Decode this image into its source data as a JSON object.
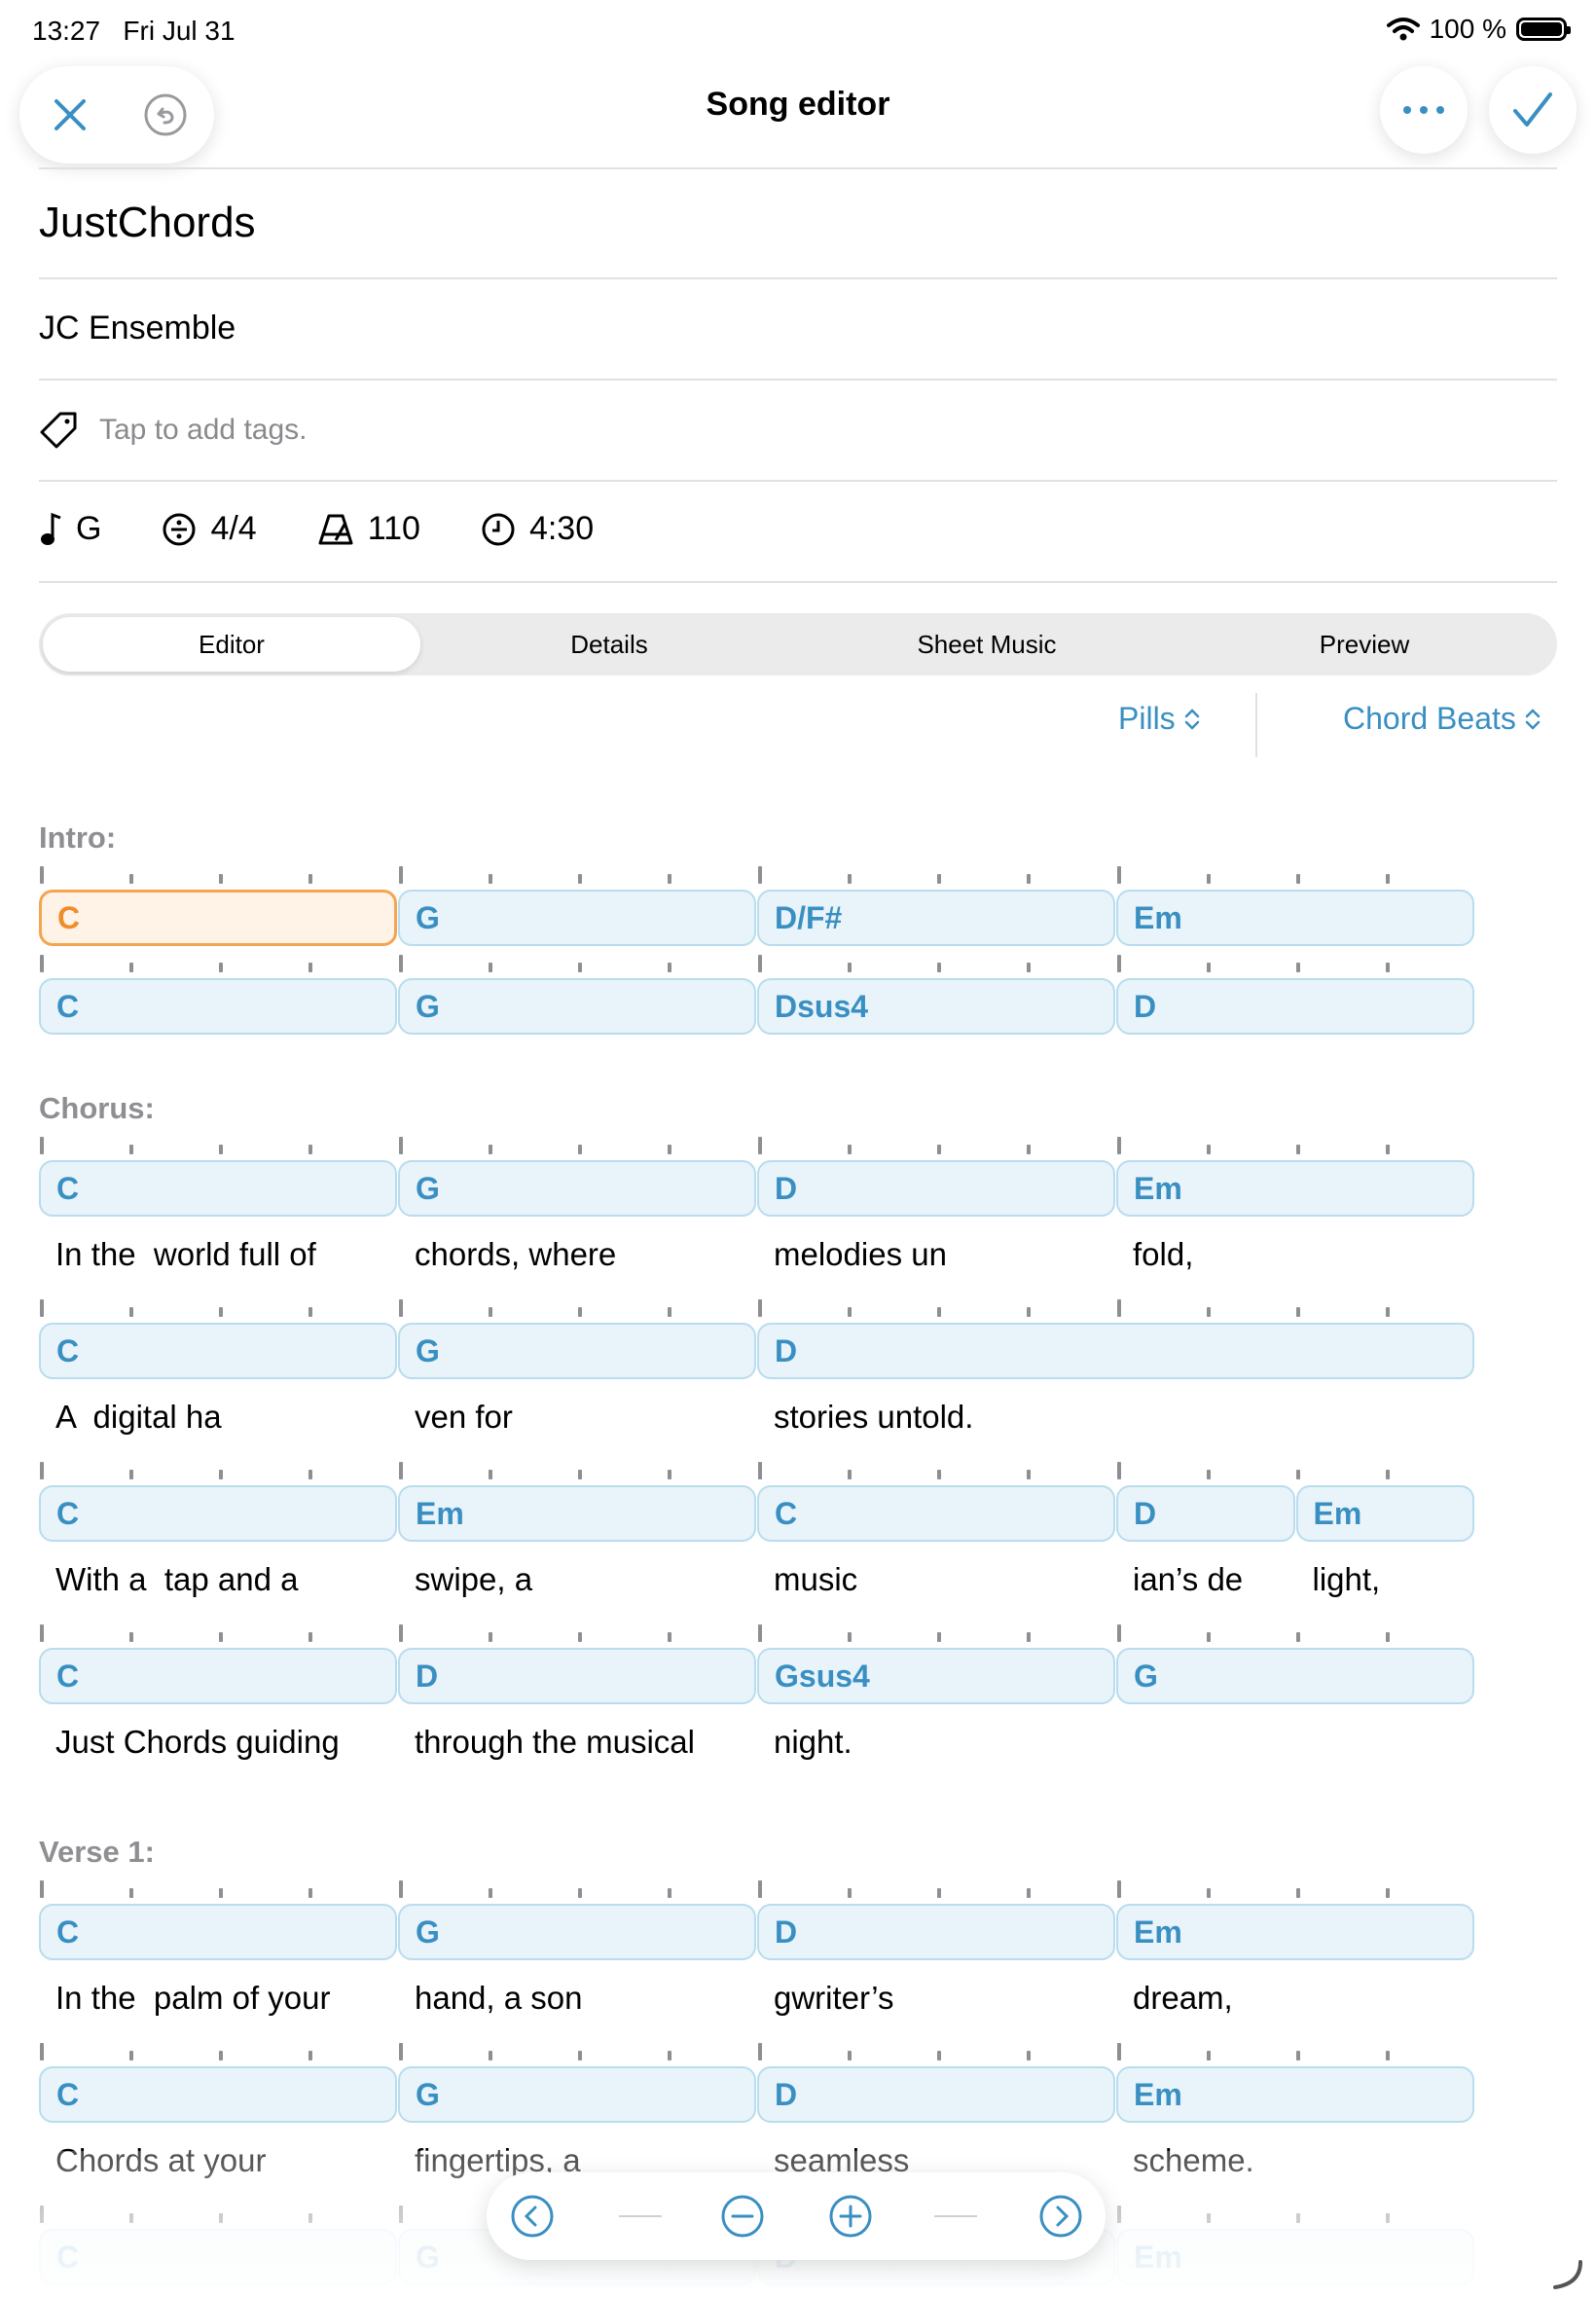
{
  "status_bar": {
    "time": "13:27",
    "date": "Fri Jul 31",
    "battery": "100 %"
  },
  "header": {
    "title": "Song editor",
    "close_icon": "close-icon",
    "undo_icon": "undo-icon",
    "more_icon": "more-icon",
    "done_icon": "checkmark-icon"
  },
  "song": {
    "title": "JustChords",
    "artist": "JC Ensemble",
    "tags_placeholder": "Tap to add tags."
  },
  "meta": {
    "key": "G",
    "time_signature": "4/4",
    "tempo": "110",
    "duration": "4:30"
  },
  "tabs": [
    "Editor",
    "Details",
    "Sheet Music",
    "Preview"
  ],
  "view_options": {
    "display": "Pills",
    "mode": "Chord Beats"
  },
  "accent_color": "#3a8fc2",
  "selection_color": "#f08c2a",
  "sections": [
    {
      "label": "Intro:",
      "lines": [
        {
          "chords": [
            [
              "C",
              1
            ],
            [
              "G",
              1
            ],
            [
              "D/F#",
              1
            ],
            [
              "Em",
              1
            ]
          ],
          "selected": 0,
          "lyrics": []
        },
        {
          "chords": [
            [
              "C",
              1
            ],
            [
              "G",
              1
            ],
            [
              "Dsus4",
              1
            ],
            [
              "D",
              1
            ]
          ],
          "lyrics": []
        }
      ]
    },
    {
      "label": "Chorus:",
      "lines": [
        {
          "chords": [
            [
              "C",
              1
            ],
            [
              "G",
              1
            ],
            [
              "D",
              1
            ],
            [
              "Em",
              1
            ]
          ],
          "lyrics": [
            "In the  world full of",
            "chords, where",
            "melodies un",
            "fold,"
          ]
        },
        {
          "chords": [
            [
              "C",
              1
            ],
            [
              "G",
              1
            ],
            [
              "D",
              2
            ]
          ],
          "lyrics": [
            "A  digital ha",
            "ven for",
            "stories untold."
          ]
        },
        {
          "chords": [
            [
              "C",
              1
            ],
            [
              "Em",
              1
            ],
            [
              "C",
              1
            ],
            [
              "D",
              0.5
            ],
            [
              "Em",
              0.5
            ]
          ],
          "lyrics": [
            "With a  tap and a",
            "swipe, a",
            "music",
            "ian’s de",
            "light,"
          ]
        },
        {
          "chords": [
            [
              "C",
              1
            ],
            [
              "D",
              1
            ],
            [
              "Gsus4",
              1
            ],
            [
              "G",
              1
            ]
          ],
          "lyrics": [
            "Just Chords guiding",
            "through the musical",
            "night."
          ]
        }
      ]
    },
    {
      "label": "Verse 1:",
      "lines": [
        {
          "chords": [
            [
              "C",
              1
            ],
            [
              "G",
              1
            ],
            [
              "D",
              1
            ],
            [
              "Em",
              1
            ]
          ],
          "lyrics": [
            "In the  palm of your",
            "hand, a son",
            "gwriter’s",
            "dream,"
          ]
        },
        {
          "chords": [
            [
              "C",
              1
            ],
            [
              "G",
              1
            ],
            [
              "D",
              1
            ],
            [
              "Em",
              1
            ]
          ],
          "lyrics": [
            "Chords at your",
            "fingertips, a",
            "seamless",
            "scheme."
          ]
        },
        {
          "chords": [
            [
              "C",
              1
            ],
            [
              "G",
              1
            ],
            [
              "D",
              1
            ],
            [
              "Em",
              1
            ]
          ],
          "lyrics": []
        }
      ]
    }
  ],
  "bottom_toolbar": [
    "previous-icon",
    "zoom-out-icon",
    "zoom-in-icon",
    "next-icon"
  ]
}
